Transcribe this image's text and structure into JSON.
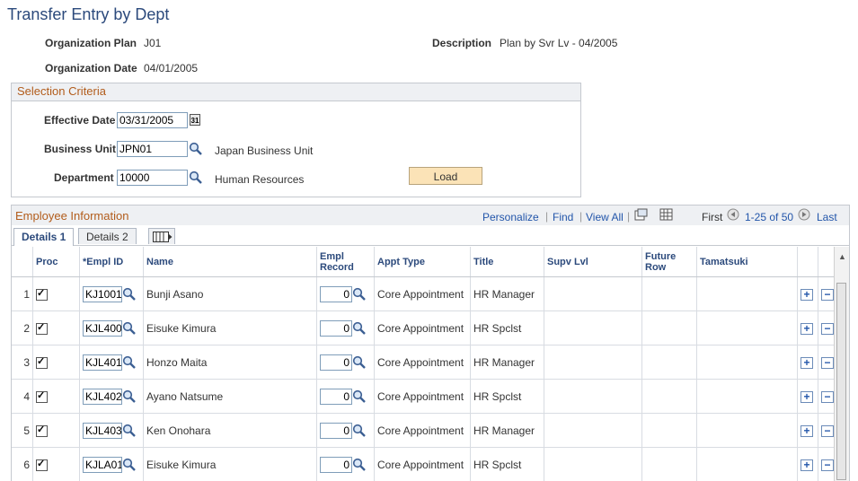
{
  "page": {
    "title": "Transfer Entry by Dept"
  },
  "header": {
    "org_plan_label": "Organization Plan",
    "org_plan_value": "J01",
    "description_label": "Description",
    "description_value": "Plan by Svr Lv - 04/2005",
    "org_date_label": "Organization Date",
    "org_date_value": "04/01/2005"
  },
  "selection": {
    "title": "Selection Criteria",
    "effective_date_label": "Effective Date",
    "effective_date_value": "03/31/2005",
    "business_unit_label": "Business Unit",
    "business_unit_value": "JPN01",
    "business_unit_desc": "Japan Business Unit",
    "department_label": "Department",
    "department_value": "10000",
    "department_desc": "Human Resources",
    "load_label": "Load"
  },
  "employees": {
    "title": "Employee Information",
    "personalize": "Personalize",
    "find": "Find",
    "view_all": "View All",
    "first": "First",
    "range": "1-25 of 50",
    "last": "Last",
    "tabs": [
      "Details 1",
      "Details 2"
    ],
    "columns": {
      "proc": "Proc",
      "empl_id": "*Empl ID",
      "name": "Name",
      "empl_record": "Empl Record",
      "appt_type": "Appt Type",
      "title": "Title",
      "supv_lvl": "Supv Lvl",
      "future_row": "Future Row",
      "tamatsuki": "Tamatsuki"
    },
    "rows": [
      {
        "num": "1",
        "empl_id": "KJ1001",
        "name": "Bunji Asano",
        "record": "0",
        "appt_type": "Core Appointment",
        "title": "HR Manager"
      },
      {
        "num": "2",
        "empl_id": "KJL400",
        "name": "Eisuke Kimura",
        "record": "0",
        "appt_type": "Core Appointment",
        "title": "HR Spclst"
      },
      {
        "num": "3",
        "empl_id": "KJL401",
        "name": "Honzo Maita",
        "record": "0",
        "appt_type": "Core Appointment",
        "title": "HR Manager"
      },
      {
        "num": "4",
        "empl_id": "KJL402",
        "name": "Ayano Natsume",
        "record": "0",
        "appt_type": "Core Appointment",
        "title": "HR Spclst"
      },
      {
        "num": "5",
        "empl_id": "KJL403",
        "name": "Ken Onohara",
        "record": "0",
        "appt_type": "Core Appointment",
        "title": "HR Manager"
      },
      {
        "num": "6",
        "empl_id": "KJLA01",
        "name": "Eisuke Kimura",
        "record": "0",
        "appt_type": "Core Appointment",
        "title": "HR Spclst"
      }
    ]
  },
  "icons": {
    "lookup": "magnifier-icon",
    "calendar": "calendar-icon",
    "add": "plus-icon",
    "delete": "minus-icon"
  },
  "colors": {
    "title": "#2c4a7c",
    "section": "#b25c1b",
    "link": "#2255aa",
    "button": "#fbe3b7"
  }
}
